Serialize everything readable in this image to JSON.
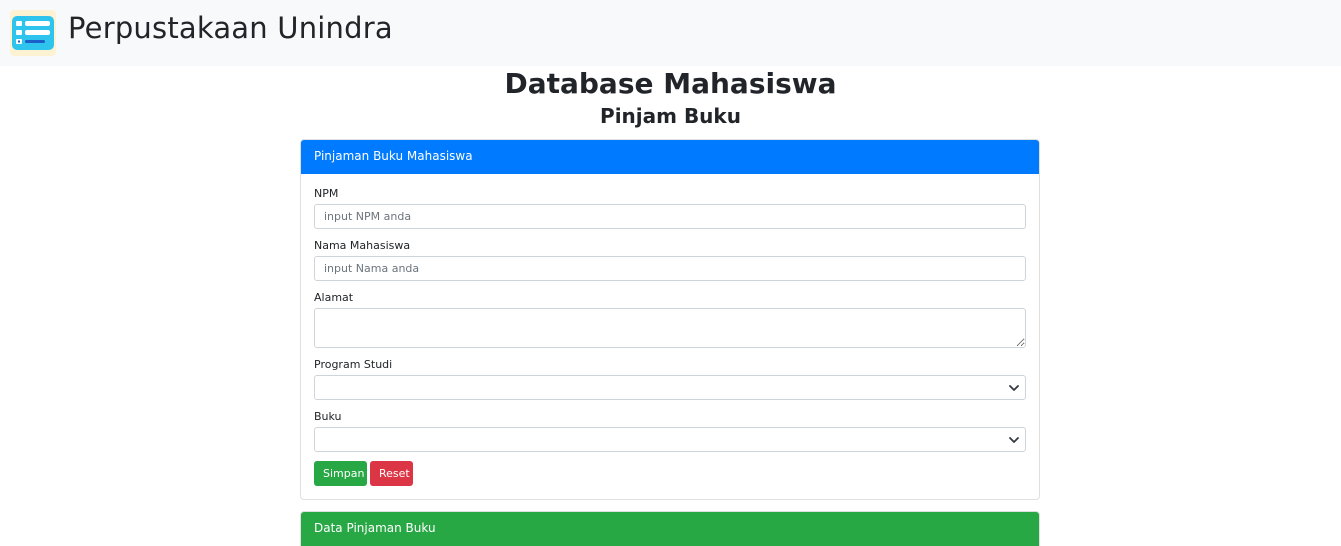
{
  "navbar": {
    "brand": "Perpustakaan Unindra",
    "logo_icon": "list-card-icon"
  },
  "page": {
    "title": "Database Mahasiswa",
    "subtitle": "Pinjam Buku"
  },
  "form_card": {
    "header": "Pinjaman Buku Mahasiswa",
    "fields": {
      "npm": {
        "label": "NPM",
        "placeholder": "input NPM anda",
        "value": ""
      },
      "nama": {
        "label": "Nama Mahasiswa",
        "placeholder": "input Nama anda",
        "value": ""
      },
      "alamat": {
        "label": "Alamat",
        "value": ""
      },
      "prodi": {
        "label": "Program Studi",
        "selected": ""
      },
      "buku": {
        "label": "Buku",
        "selected": ""
      }
    },
    "buttons": {
      "save": "Simpan",
      "reset": "Reset"
    }
  },
  "data_card": {
    "header": "Data Pinjaman Buku"
  },
  "colors": {
    "primary": "#007bff",
    "success": "#28a745",
    "danger": "#dc3545",
    "navbar_bg": "#f8f9fa"
  }
}
